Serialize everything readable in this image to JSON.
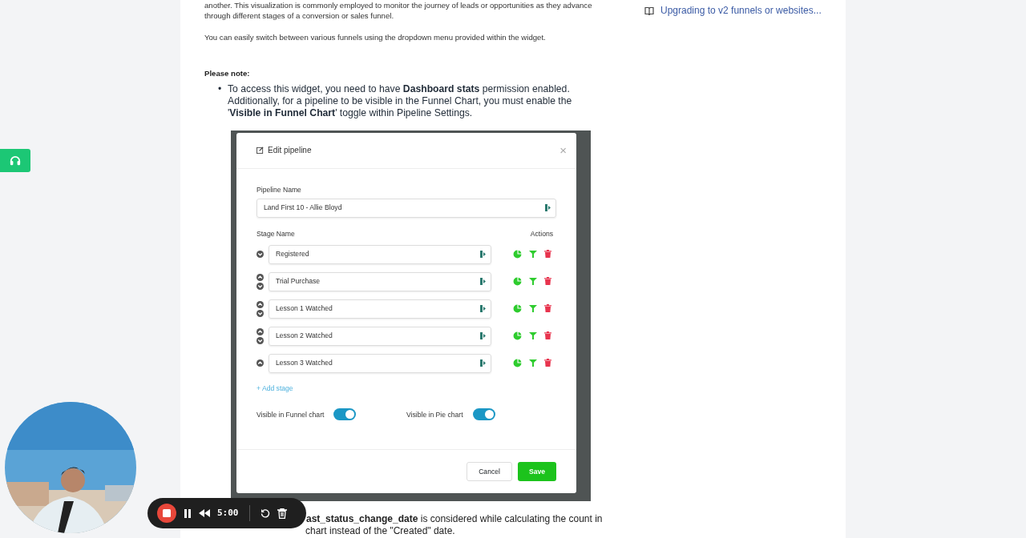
{
  "article": {
    "intro_lines": [
      "another. This visualization is commonly employed to monitor the journey of leads or opportunities as they advance",
      "through different stages of a conversion or sales funnel."
    ],
    "switch_note": "You can easily switch between various funnels using the dropdown menu provided within the widget.",
    "note_heading": "Please note:",
    "bullets": [
      {
        "marker": "•",
        "text": "To access this widget, you need to have **Dashboard stats** permission enabled. Additionally, for a pipeline to be visible in the Funnel Chart, you must enable the '**Visible in Funnel Chart**' toggle within Pipeline Settings."
      }
    ],
    "screenshot": {
      "title": "Edit pipeline",
      "close": "×",
      "pipeline_label": "Pipeline Name",
      "pipeline_value": "Land First 10 - Allie Bloyd",
      "stage_label": "Stage Name",
      "actions_label": "Actions",
      "stages": [
        {
          "value": "Registered",
          "can_move_up": false,
          "can_move_down": true
        },
        {
          "value": "Trial Purchase",
          "can_move_up": true,
          "can_move_down": true
        },
        {
          "value": "Lesson 1 Watched",
          "can_move_up": true,
          "can_move_down": true
        },
        {
          "value": "Lesson 2 Watched",
          "can_move_up": true,
          "can_move_down": true
        },
        {
          "value": "Lesson 3 Watched",
          "can_move_up": true,
          "can_move_down": false
        }
      ],
      "add_stage": "+ Add stage",
      "toggles": [
        {
          "label": "Visible in Funnel chart",
          "on": true
        },
        {
          "label": "Visible in Pie chart",
          "on": true
        }
      ],
      "buttons": [
        {
          "label": "Cancel",
          "kind": "secondary"
        },
        {
          "label": "Save",
          "kind": "primary"
        }
      ]
    },
    "after_lines": [
      "**ast_status_change_date** is considered while calculating the count in",
      "chart instead of the \"Created\" date."
    ]
  },
  "sidebar": {
    "links": [
      {
        "label": "Upgrading to v2 funnels or websites..."
      }
    ]
  },
  "recorder": {
    "time": "5:00"
  }
}
